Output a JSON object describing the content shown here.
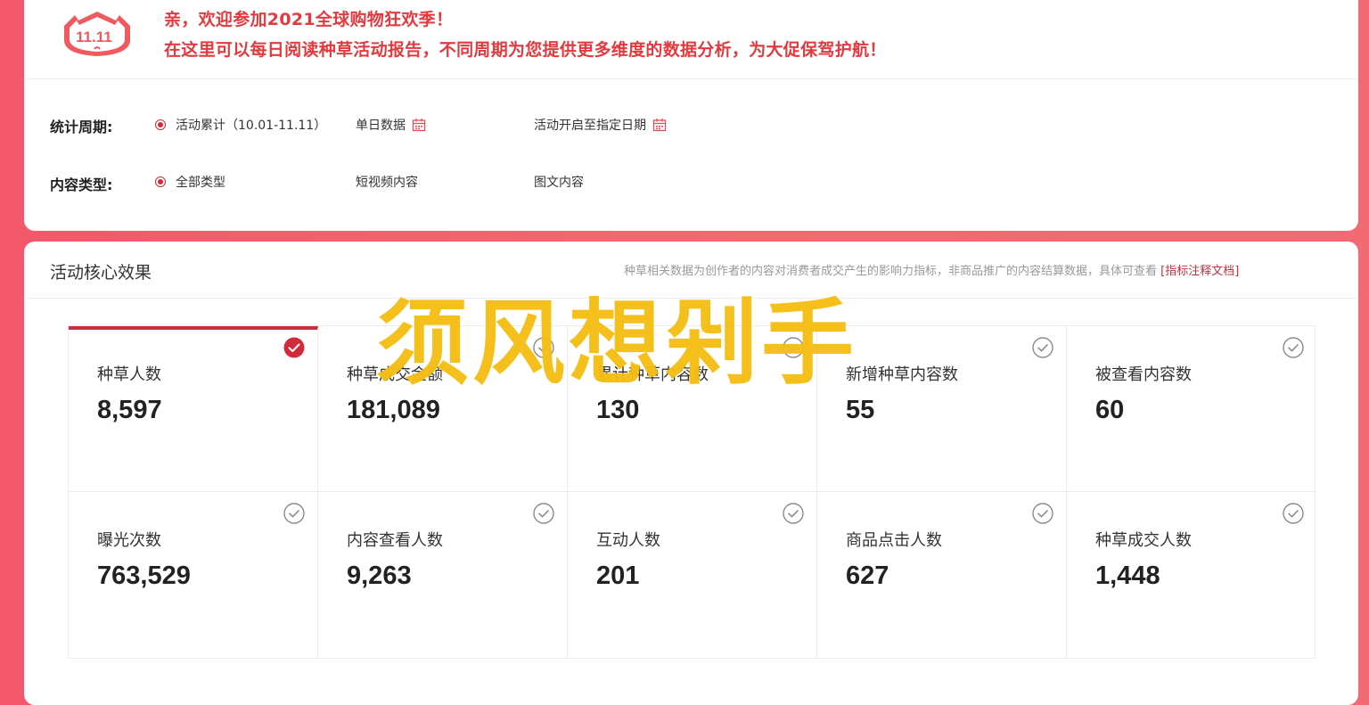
{
  "banner": {
    "line1": "亲，欢迎参加2021全球购物狂欢季！",
    "line2": "在这里可以每日阅读种草活动报告，不同周期为您提供更多维度的数据分析，为大促保驾护航！",
    "accent_color": "#e23a3f"
  },
  "filters": {
    "period": {
      "label": "统计周期:",
      "options": [
        {
          "label": "活动累计（10.01-11.11）",
          "selected": true
        },
        {
          "label": "单日数据",
          "selected": false,
          "icon": "calendar-icon"
        },
        {
          "label": "活动开启至指定日期",
          "selected": false,
          "icon": "calendar-icon"
        }
      ]
    },
    "content_type": {
      "label": "内容类型:",
      "options": [
        {
          "label": "全部类型",
          "selected": true
        },
        {
          "label": "短视频内容",
          "selected": false
        },
        {
          "label": "图文内容",
          "selected": false
        }
      ]
    }
  },
  "core": {
    "title": "活动核心效果",
    "note": "种草相关数据为创作者的内容对消费者成交产生的影响力指标，非商品推广的内容结算数据，具体可查看",
    "link": "[指标注释文档]",
    "metrics": [
      {
        "label": "种草人数",
        "value": "8,597",
        "selected": true
      },
      {
        "label": "种草成交金额",
        "value": "181,089",
        "selected": false
      },
      {
        "label": "累计种草内容数",
        "value": "130",
        "selected": false
      },
      {
        "label": "新增种草内容数",
        "value": "55",
        "selected": false
      },
      {
        "label": "被查看内容数",
        "value": "60",
        "selected": false
      },
      {
        "label": "曝光次数",
        "value": "763,529",
        "selected": false
      },
      {
        "label": "内容查看人数",
        "value": "9,263",
        "selected": false
      },
      {
        "label": "互动人数",
        "value": "201",
        "selected": false
      },
      {
        "label": "商品点击人数",
        "value": "627",
        "selected": false
      },
      {
        "label": "种草成交人数",
        "value": "1,448",
        "selected": false
      }
    ]
  },
  "watermark": "须风想剁手",
  "colors": {
    "brand": "#d22a3a",
    "background": "#f2586a",
    "watermark": "#f5be12"
  }
}
